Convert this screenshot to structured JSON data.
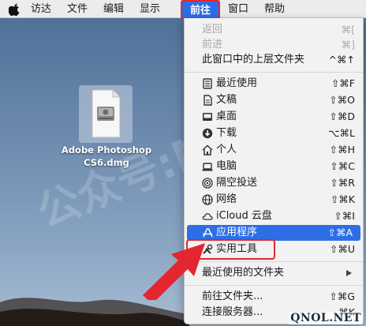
{
  "menubar": {
    "items": [
      "访达",
      "文件",
      "编辑",
      "显示",
      "前往",
      "窗口",
      "帮助"
    ]
  },
  "desktop": {
    "file_label_line1": "Adobe Photoshop",
    "file_label_line2": "CS6.dmg",
    "watermark_text": "公众号:Mac软件"
  },
  "go_menu": {
    "back": {
      "label": "返回",
      "shortcut": "⌘["
    },
    "forward": {
      "label": "前进",
      "shortcut": "⌘]"
    },
    "enclosing": {
      "label": "此窗口中的上层文件夹",
      "shortcut": "^⌘↑"
    },
    "recents": {
      "label": "最近使用",
      "shortcut": "⇧⌘F",
      "icon": "recents-icon"
    },
    "documents": {
      "label": "文稿",
      "shortcut": "⇧⌘O",
      "icon": "documents-icon"
    },
    "desktop": {
      "label": "桌面",
      "shortcut": "⇧⌘D",
      "icon": "desktop-icon"
    },
    "downloads": {
      "label": "下载",
      "shortcut": "⌥⌘L",
      "icon": "downloads-icon"
    },
    "home": {
      "label": "个人",
      "shortcut": "⇧⌘H",
      "icon": "home-icon"
    },
    "computer": {
      "label": "电脑",
      "shortcut": "⇧⌘C",
      "icon": "computer-icon"
    },
    "airdrop": {
      "label": "隔空投送",
      "shortcut": "⇧⌘R",
      "icon": "airdrop-icon"
    },
    "network": {
      "label": "网络",
      "shortcut": "⇧⌘K",
      "icon": "network-icon"
    },
    "icloud": {
      "label": "iCloud 云盘",
      "shortcut": "⇧⌘I",
      "icon": "icloud-icon"
    },
    "applications": {
      "label": "应用程序",
      "shortcut": "⇧⌘A",
      "icon": "applications-icon"
    },
    "utilities": {
      "label": "实用工具",
      "shortcut": "⇧⌘U",
      "icon": "utilities-icon"
    },
    "recent_folders": {
      "label": "最近使用的文件夹"
    },
    "go_to_folder": {
      "label": "前往文件夹...",
      "shortcut": "⇧⌘G"
    },
    "connect_server": {
      "label": "连接服务器...",
      "shortcut": "⌘K"
    }
  },
  "colors": {
    "highlight": "#2d6ee6",
    "annotation": "#e3262f"
  },
  "site_mark": "QNOL.NET"
}
